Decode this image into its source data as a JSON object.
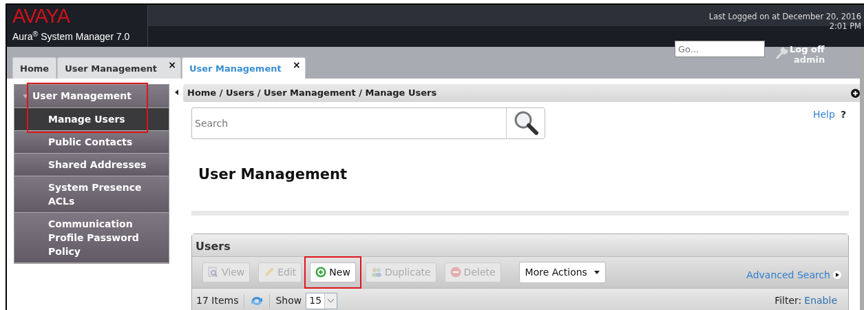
{
  "header": {
    "logo": "AVAYA",
    "product": "Aura$^{®}$ System Manager 7.0",
    "last_login": "Last Logged on at December 20, 2016",
    "last_login_time": "2:01 PM",
    "go_field": {
      "placeholder": "Go..."
    },
    "log_off": "Log off",
    "user": "admin"
  },
  "tabs": [
    {
      "label": "Home",
      "selected": false
    },
    {
      "label": "User Management",
      "selected": false,
      "close": "×"
    },
    {
      "label": "User Management",
      "selected": true,
      "close": "×"
    }
  ],
  "sidebar": {
    "title": "User Management",
    "expanded": true,
    "highlighted": true,
    "items": [
      {
        "label": "Manage Users",
        "selected": true
      },
      {
        "label": "Public Contacts",
        "selected": false
      },
      {
        "label": "Shared Addresses",
        "selected": false
      },
      {
        "label": "System Presence ACLs",
        "selected": false
      },
      {
        "label": "Communication Profile Password Policy",
        "selected": false
      }
    ]
  },
  "breadcrumb": "Home / Users / User Management / Manage Users",
  "search": {
    "placeholder": "Search"
  },
  "help": {
    "label": "Help",
    "mark": "?"
  },
  "page_title": "User Management",
  "users_panel": {
    "title": "Users",
    "toolbar": [
      {
        "kind": "button",
        "label": "View",
        "disabled": true,
        "highlighted": false
      },
      {
        "kind": "button",
        "label": "Edit",
        "disabled": true,
        "highlighted": false
      },
      {
        "kind": "button",
        "label": "New",
        "disabled": false,
        "highlighted": true
      },
      {
        "kind": "button",
        "label": "Duplicate",
        "disabled": true,
        "highlighted": false
      },
      {
        "kind": "button",
        "label": "Delete",
        "disabled": true,
        "highlighted": false
      },
      {
        "kind": "dropdown",
        "label": "More Actions",
        "disabled": false,
        "highlighted": false
      }
    ],
    "advanced_search": "Advanced Search",
    "items_count": "17 Items",
    "show_label": "Show",
    "show_value": "15",
    "filter_label": "Filter:",
    "filter_link": "Enable"
  }
}
